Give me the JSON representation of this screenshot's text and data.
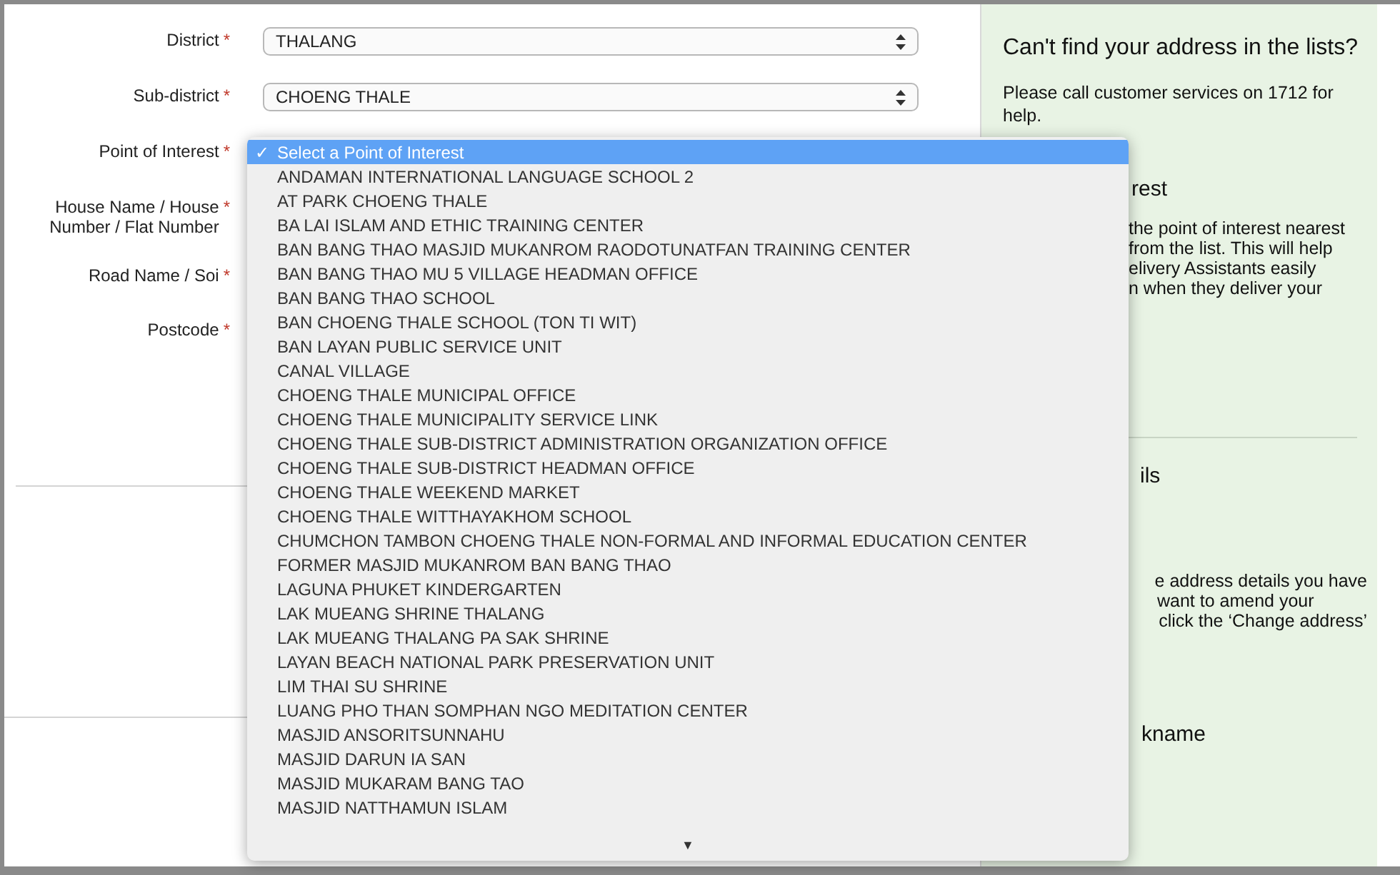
{
  "form": {
    "fields": [
      {
        "label": "District",
        "mark": "*",
        "kind": "select",
        "value": "THALANG"
      },
      {
        "label": "Sub-district",
        "mark": "*",
        "kind": "select",
        "value": "CHOENG THALE"
      },
      {
        "label": "Point of Interest",
        "mark": "*",
        "kind": "open-select"
      },
      {
        "label": "House Name / House Number / Flat Number",
        "mark": "*",
        "kind": "text"
      },
      {
        "label": "Road Name / Soi",
        "mark": "*",
        "kind": "text"
      },
      {
        "label": "Postcode",
        "mark": "*",
        "kind": "text"
      }
    ]
  },
  "dropdown": {
    "check": "✓",
    "more_arrow": "▼",
    "items": [
      {
        "label": "Select a Point of Interest",
        "selected": true
      },
      {
        "label": "ANDAMAN INTERNATIONAL LANGUAGE SCHOOL 2",
        "selected": false
      },
      {
        "label": "AT PARK CHOENG THALE",
        "selected": false
      },
      {
        "label": "BA LAI ISLAM AND ETHIC TRAINING CENTER",
        "selected": false
      },
      {
        "label": "BAN BANG THAO MASJID MUKANROM RAODOTUNATFAN TRAINING CENTER",
        "selected": false
      },
      {
        "label": "BAN BANG THAO MU 5 VILLAGE HEADMAN OFFICE",
        "selected": false
      },
      {
        "label": "BAN BANG THAO SCHOOL",
        "selected": false
      },
      {
        "label": "BAN CHOENG THALE SCHOOL (TON TI WIT)",
        "selected": false
      },
      {
        "label": "BAN LAYAN PUBLIC SERVICE UNIT",
        "selected": false
      },
      {
        "label": "CANAL VILLAGE",
        "selected": false
      },
      {
        "label": "CHOENG THALE MUNICIPAL OFFICE",
        "selected": false
      },
      {
        "label": "CHOENG THALE MUNICIPALITY SERVICE LINK",
        "selected": false
      },
      {
        "label": "CHOENG THALE SUB-DISTRICT ADMINISTRATION ORGANIZATION OFFICE",
        "selected": false
      },
      {
        "label": "CHOENG THALE SUB-DISTRICT HEADMAN OFFICE",
        "selected": false
      },
      {
        "label": "CHOENG THALE WEEKEND MARKET",
        "selected": false
      },
      {
        "label": "CHOENG THALE WITTHAYAKHOM SCHOOL",
        "selected": false
      },
      {
        "label": "CHUMCHON TAMBON CHOENG THALE NON-FORMAL AND INFORMAL EDUCATION CENTER",
        "selected": false
      },
      {
        "label": "FORMER MASJID MUKANROM BAN BANG THAO",
        "selected": false
      },
      {
        "label": "LAGUNA PHUKET KINDERGARTEN",
        "selected": false
      },
      {
        "label": "LAK MUEANG SHRINE THALANG",
        "selected": false
      },
      {
        "label": "LAK MUEANG THALANG PA SAK SHRINE",
        "selected": false
      },
      {
        "label": "LAYAN BEACH NATIONAL PARK PRESERVATION UNIT",
        "selected": false
      },
      {
        "label": "LIM THAI SU SHRINE",
        "selected": false
      },
      {
        "label": "LUANG PHO THAN SOMPHAN NGO MEDITATION CENTER",
        "selected": false
      },
      {
        "label": "MASJID ANSORITSUNNAHU",
        "selected": false
      },
      {
        "label": "MASJID DARUN IA SAN",
        "selected": false
      },
      {
        "label": "MASJID MUKARAM BANG TAO",
        "selected": false
      },
      {
        "label": "MASJID NATTHAMUN ISLAM",
        "selected": false
      }
    ]
  },
  "side_panel": {
    "heading": "Can't find your address in the lists?",
    "text": "Please call customer services on 1712 for help.",
    "poi_heading": "rest",
    "poi_lines": [
      "the point of interest nearest",
      "from the list. This will help",
      "elivery Assistants easily",
      "n when they deliver your"
    ],
    "details_heading": "ils",
    "details_lines": [
      "e address details you have",
      "want to amend your",
      "click the ‘Change address’"
    ],
    "nickname_heading": "kname"
  }
}
